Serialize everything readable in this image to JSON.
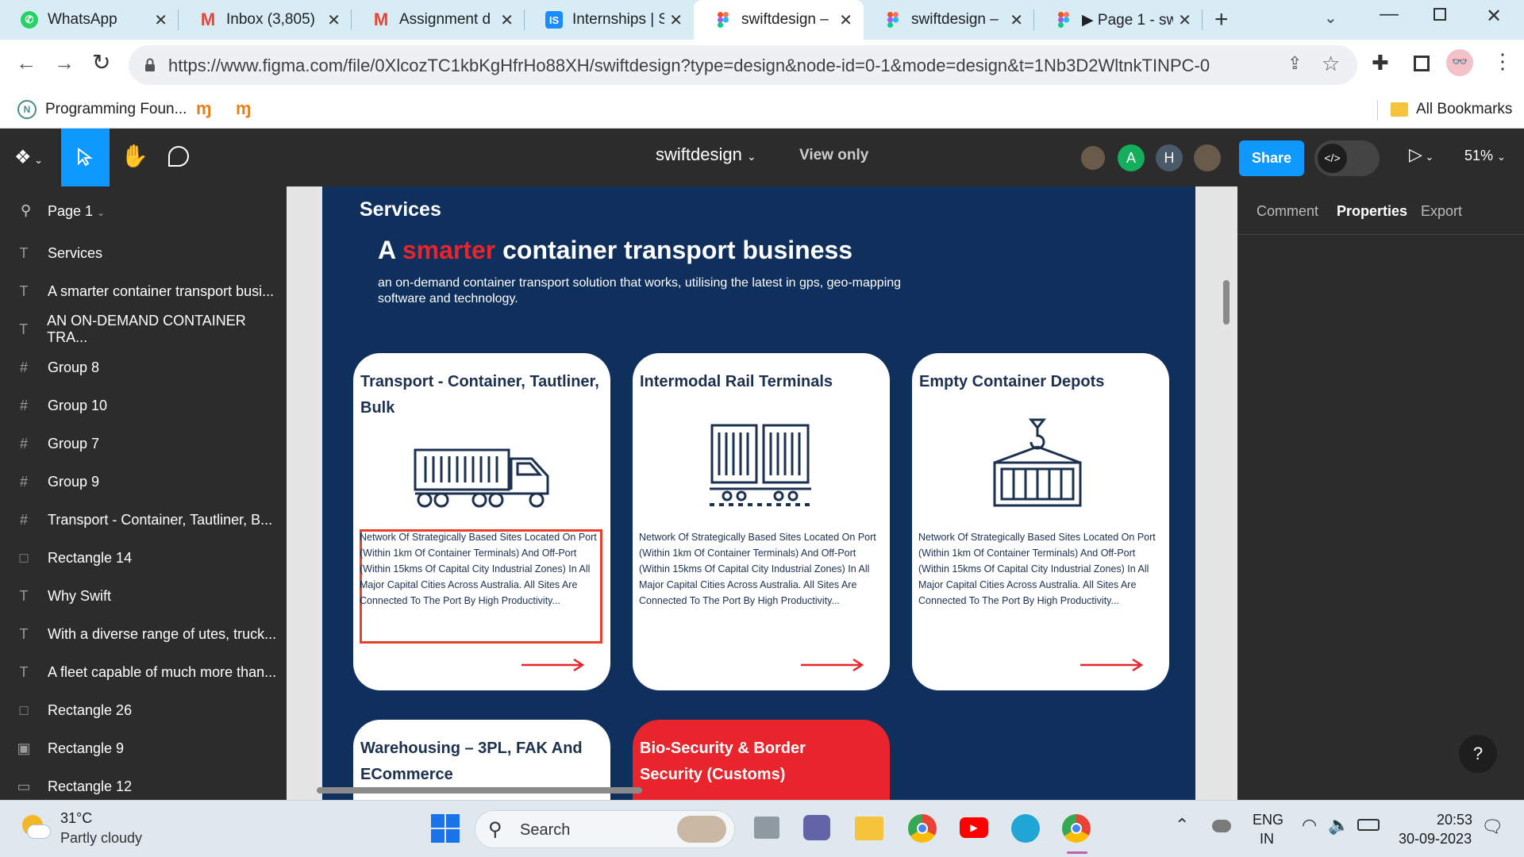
{
  "browser": {
    "tabs": [
      {
        "title": "WhatsApp",
        "icon": "whatsapp-icon",
        "active": false
      },
      {
        "title": "Inbox (3,805)",
        "icon": "gmail-icon",
        "active": false
      },
      {
        "title": "Assignment d",
        "icon": "gmail-icon",
        "active": false
      },
      {
        "title": "Internships | S",
        "icon": "internshala-icon",
        "active": false
      },
      {
        "title": "swiftdesign –",
        "icon": "figma-icon",
        "active": true
      },
      {
        "title": "swiftdesign –",
        "icon": "figma-icon",
        "active": false
      },
      {
        "title": "▶ Page 1 - sw",
        "icon": "figma-icon",
        "active": false
      }
    ],
    "url": "https://www.figma.com/file/0XlcozTC1kbKgHfrHo88XH/swiftdesign?type=design&node-id=0-1&mode=design&t=1Nb3D2WltnkTINPC-0",
    "bookmarks": [
      {
        "label": "Programming Foun..."
      }
    ],
    "all_bookmarks": "All Bookmarks"
  },
  "figma": {
    "file_name": "swiftdesign",
    "view_mode": "View only",
    "avatars": [
      "A",
      "H"
    ],
    "share_label": "Share",
    "zoom": "51%",
    "page_name": "Page 1",
    "right_tabs": [
      "Comment",
      "Properties",
      "Export"
    ],
    "layers": [
      {
        "type": "T",
        "name": "Services"
      },
      {
        "type": "T",
        "name": "A smarter container transport busi..."
      },
      {
        "type": "T",
        "name": "AN ON-DEMAND CONTAINER TRA..."
      },
      {
        "type": "#",
        "name": "Group 8"
      },
      {
        "type": "#",
        "name": "Group 10"
      },
      {
        "type": "#",
        "name": "Group 7"
      },
      {
        "type": "#",
        "name": "Group 9"
      },
      {
        "type": "#",
        "name": "Transport - Container, Tautliner, B..."
      },
      {
        "type": "□",
        "name": "Rectangle 14"
      },
      {
        "type": "T",
        "name": "Why Swift"
      },
      {
        "type": "T",
        "name": "With a diverse range of utes, truck..."
      },
      {
        "type": "T",
        "name": "A fleet capable of much more than..."
      },
      {
        "type": "□",
        "name": "Rectangle 26"
      },
      {
        "type": "▣",
        "name": "Rectangle 9"
      },
      {
        "type": "▭",
        "name": "Rectangle 12"
      }
    ]
  },
  "design": {
    "section_label": "Services",
    "headline_a": "A",
    "headline_highlight": "smarter",
    "headline_rest": "container transport business",
    "subtext_line1": "an on-demand container transport solution that works, utilising the latest in gps, geo-mapping",
    "subtext_line2": "software and technology.",
    "cards": [
      {
        "title": "Transport - Container, Tautliner, Bulk",
        "icon": "truck-icon",
        "body": "Network Of Strategically Based Sites Located On Port (Within 1km Of Container Terminals) And Off-Port (Within 15kms Of Capital City Industrial Zones) In All Major Capital Cities Across Australia. All Sites Are Connected To The Port By High Productivity..."
      },
      {
        "title": "Intermodal Rail Terminals",
        "icon": "rail-wagon-icon",
        "body": "Network Of Strategically Based Sites Located On Port (Within 1km Of Container Terminals) And Off-Port (Within 15kms Of Capital City Industrial Zones) In All Major Capital Cities Across Australia. All Sites Are Connected To The Port By High Productivity..."
      },
      {
        "title": "Empty Container Depots",
        "icon": "container-crane-icon",
        "body": "Network Of Strategically Based Sites Located On Port (Within 1km Of Container Terminals) And Off-Port (Within 15kms Of Capital City Industrial Zones) In All Major Capital Cities Across Australia. All Sites Are Connected To The Port By High Productivity..."
      },
      {
        "title": "Warehousing – 3PL, FAK And ECommerce"
      },
      {
        "title": "Bio-Security & Border Security (Customs)"
      }
    ],
    "colors": {
      "navy": "#0f2f5d",
      "accent_red": "#e8242c",
      "card_text": "#1c3050"
    }
  },
  "taskbar": {
    "weather_temp": "31°C",
    "weather_desc": "Partly cloudy",
    "search_label": "Search",
    "lang_line1": "ENG",
    "lang_line2": "IN",
    "time": "20:53",
    "date": "30-09-2023"
  }
}
